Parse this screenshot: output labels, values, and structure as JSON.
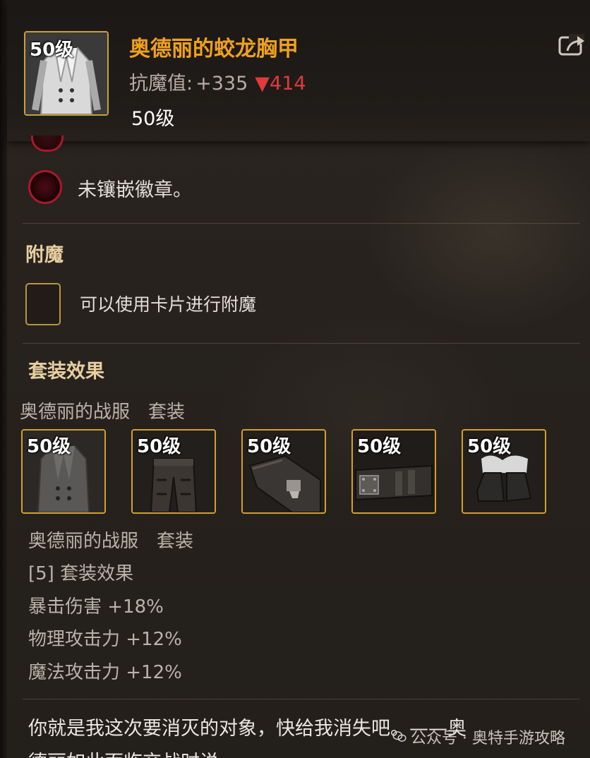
{
  "item": {
    "level_badge": "50级",
    "name": "奥德丽的蛟龙胸甲",
    "resistance_label": "抗魔值:",
    "resistance_value": "+335",
    "resistance_diff": "▼414",
    "level_text": "50级",
    "share_icon": "share-icon"
  },
  "socket": {
    "text": "未镶嵌徽章。",
    "color": "#b0152a"
  },
  "enchant": {
    "title": "附魔",
    "hint": "可以使用卡片进行附魔"
  },
  "set": {
    "title": "套装效果",
    "name_header": "奥德丽的战服　套装",
    "pieces": [
      {
        "level": "50级",
        "icon": "coat-icon"
      },
      {
        "level": "50级",
        "icon": "pants-icon"
      },
      {
        "level": "50级",
        "icon": "shoulder-icon"
      },
      {
        "level": "50级",
        "icon": "belt-icon"
      },
      {
        "level": "50级",
        "icon": "boots-icon"
      }
    ],
    "name_footer": "奥德丽的战服　套装",
    "bonus_label": "[5] 套装效果",
    "bonuses": [
      "暴击伤害 +18%",
      "物理攻击力 +12%",
      "魔法攻击力 +12%"
    ]
  },
  "flavor": {
    "line1": "你就是我这次要消灭的对象，快给我消失吧。——奥",
    "line2": "德丽如此面临交战时说"
  },
  "watermark": "公众号 · 奥特手游攻略",
  "colors": {
    "name": "#f0a020",
    "diff_down": "#e23a3a",
    "border_gold": "#d4a02a",
    "section_title": "#e8cfa0"
  }
}
